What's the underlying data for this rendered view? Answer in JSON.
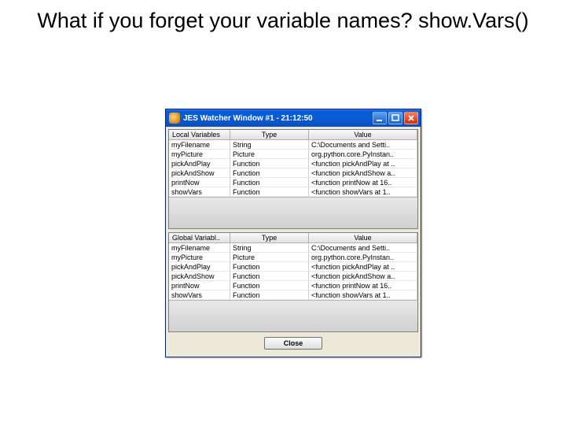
{
  "slide": {
    "title": "What if you forget your variable names?  show.Vars()"
  },
  "window": {
    "title": "JES Watcher Window #1 - 21:12:50",
    "buttons": {
      "min": "_",
      "max": "□",
      "close": "×"
    },
    "closeLabel": "Close"
  },
  "localHeader": {
    "c0": "Local Variables",
    "c1": "Type",
    "c2": "Value"
  },
  "globalHeader": {
    "c0": "Global Variabl..",
    "c1": "Type",
    "c2": "Value"
  },
  "localRows": [
    {
      "name": "myFilename",
      "type": "String",
      "value": "C:\\Documents and Setti.."
    },
    {
      "name": "myPicture",
      "type": "Picture",
      "value": "org.python.core.PyInstan.."
    },
    {
      "name": "pickAndPlay",
      "type": "Function",
      "value": "<function pickAndPlay at .."
    },
    {
      "name": "pickAndShow",
      "type": "Function",
      "value": "<function pickAndShow a.."
    },
    {
      "name": "printNow",
      "type": "Function",
      "value": "<function printNow at 16.."
    },
    {
      "name": "showVars",
      "type": "Function",
      "value": "<function showVars at 1.."
    }
  ],
  "globalRows": [
    {
      "name": "myFilename",
      "type": "String",
      "value": "C:\\Documents and Setti.."
    },
    {
      "name": "myPicture",
      "type": "Picture",
      "value": "org.python.core.PyInstan.."
    },
    {
      "name": "pickAndPlay",
      "type": "Function",
      "value": "<function pickAndPlay at .."
    },
    {
      "name": "pickAndShow",
      "type": "Function",
      "value": "<function pickAndShow a.."
    },
    {
      "name": "printNow",
      "type": "Function",
      "value": "<function printNow at 16.."
    },
    {
      "name": "showVars",
      "type": "Function",
      "value": "<function showVars at 1.."
    }
  ]
}
